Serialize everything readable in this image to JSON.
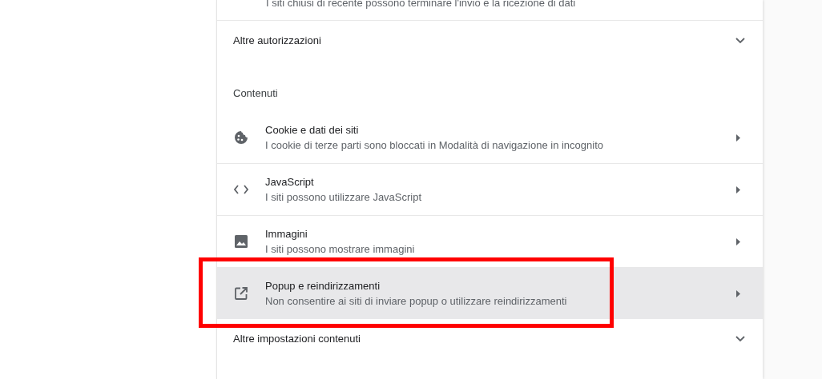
{
  "partial_row": {
    "subtitle": "I siti chiusi di recente possono terminare l'invio e la ricezione di dati"
  },
  "more_permissions": {
    "label": "Altre autorizzazioni",
    "expanded": false
  },
  "content_section": {
    "heading": "Contenuti",
    "items": [
      {
        "kind": "cookie",
        "title": "Cookie e dati dei siti",
        "subtitle": "I cookie di terze parti sono bloccati in Modalità di navigazione in incognito",
        "selected": false
      },
      {
        "kind": "code",
        "title": "JavaScript",
        "subtitle": "I siti possono utilizzare JavaScript",
        "selected": false
      },
      {
        "kind": "image",
        "title": "Immagini",
        "subtitle": "I siti possono mostrare immagini",
        "selected": false
      },
      {
        "kind": "popup",
        "title": "Popup e reindirizzamenti",
        "subtitle": "Non consentire ai siti di inviare popup o utilizzare reindirizzamenti",
        "selected": true
      }
    ]
  },
  "more_content_settings": {
    "label": "Altre impostazioni contenuti",
    "expanded": false
  }
}
